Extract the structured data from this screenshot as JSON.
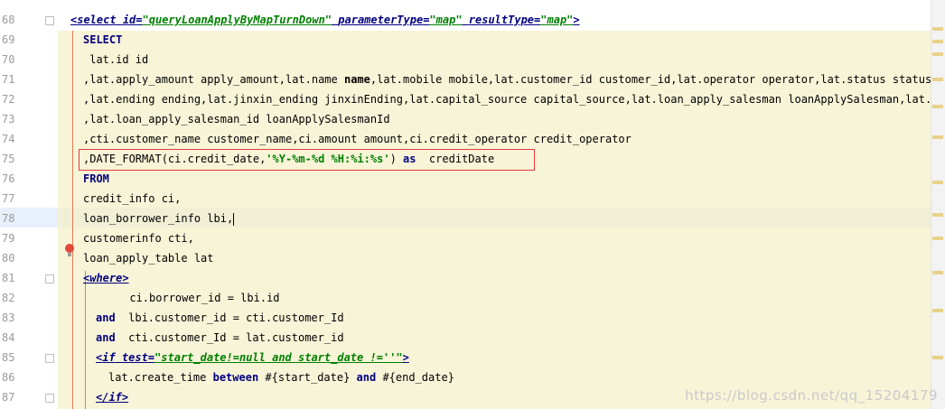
{
  "line_numbers": [
    "68",
    "69",
    "70",
    "71",
    "72",
    "73",
    "74",
    "75",
    "76",
    "77",
    "78",
    "79",
    "80",
    "81",
    "82",
    "83",
    "84",
    "85",
    "86",
    "87"
  ],
  "code": {
    "l68": {
      "lt": "<",
      "tag": "select",
      "sp1": " ",
      "a1": "id",
      "e1": "=",
      "v1": "\"queryLoanApplyByMapTurnDown\"",
      "sp2": " ",
      "a2": "parameterType",
      "e2": "=",
      "v2": "\"map\"",
      "sp3": " ",
      "a3": "resultType",
      "e3": "=",
      "v3": "\"map\"",
      "gt": ">"
    },
    "l69": "SELECT",
    "l70": " lat.id id",
    "l71a": ",lat.apply_amount apply_amount,lat.name ",
    "l71b": "name",
    "l71c": ",lat.mobile mobile,lat.customer_id customer_id,lat.operator operator,lat.status status",
    "l72": ",lat.ending ending,lat.jinxin_ending jinxinEnding,lat.capital_source capital_source,lat.loan_apply_salesman loanApplySalesman,lat.capit",
    "l73": ",lat.loan_apply_salesman_id loanApplySalesmanId",
    "l74": ",cti.customer_name customer_name,ci.amount amount,ci.credit_operator credit_operator",
    "l75a": ",DATE_FORMAT(ci.credit_date,",
    "l75b": "'%Y-%m-%d %H:%i:%s'",
    "l75c": ") ",
    "l75d": "as",
    "l75e": "  creditDate",
    "l76": "FROM",
    "l77": "credit_info ci,",
    "l78": "loan_borrower_info lbi,",
    "l79": "customerinfo cti,",
    "l80": "loan_apply_table lat",
    "l81": {
      "lt": "<",
      "tag": "where",
      "gt": ">"
    },
    "l82": "      ci.borrower_id = lbi.id",
    "l83a": "and",
    "l83b": "  lbi.customer_id = cti.customer_Id",
    "l84a": "and",
    "l84b": "  cti.customer_Id = lat.customer_id",
    "l85": {
      "lt": "<",
      "tag": "if",
      "sp": " ",
      "a1": "test",
      "e1": "=",
      "v1": "\"start_date!=null and start_date !=''\"",
      "gt": ">"
    },
    "l86a": "lat.create_time ",
    "l86b": "between",
    "l86c": " #{start_date} ",
    "l86d": "and",
    "l86e": " #{end_date}",
    "l87": {
      "lt": "</",
      "tag": "if",
      "gt": ">"
    }
  },
  "watermark": "https://blog.csdn.net/qq_15204179",
  "colors": {
    "code_bg": "#f8f4d8",
    "keyword": "#000080",
    "string": "#008000",
    "highlight_box": "#e23a3a"
  }
}
